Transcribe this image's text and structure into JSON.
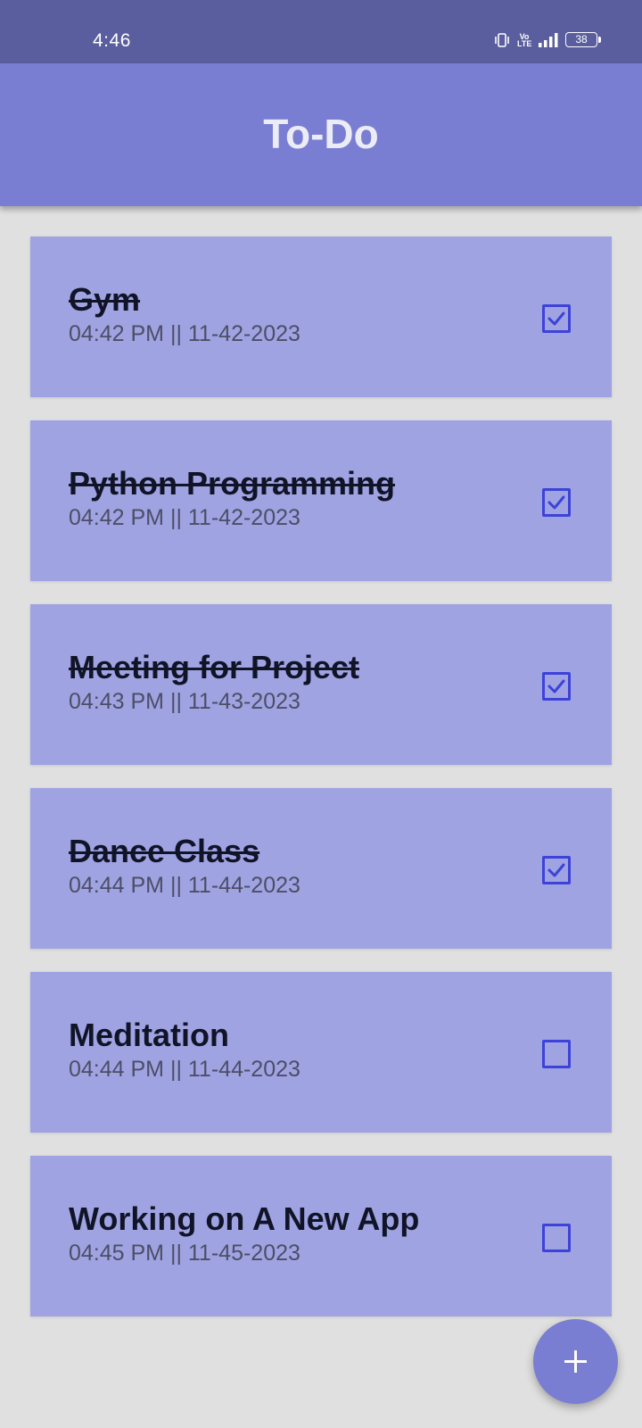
{
  "status_bar": {
    "time": "4:46",
    "volte": "Vo\nLTE",
    "battery": "38"
  },
  "app_bar": {
    "title": "To-Do"
  },
  "todos": [
    {
      "title": "Gym",
      "time": "04:42 PM || 11-42-2023",
      "done": true
    },
    {
      "title": "Python Programming",
      "time": "04:42 PM || 11-42-2023",
      "done": true
    },
    {
      "title": "Meeting for Project",
      "time": "04:43 PM || 11-43-2023",
      "done": true
    },
    {
      "title": "Dance Class",
      "time": "04:44 PM || 11-44-2023",
      "done": true
    },
    {
      "title": "Meditation",
      "time": "04:44 PM || 11-44-2023",
      "done": false
    },
    {
      "title": "Working on A New App",
      "time": "04:45 PM || 11-45-2023",
      "done": false
    }
  ],
  "fab": {
    "icon": "plus-icon"
  },
  "colors": {
    "status_bar": "#5a5e9e",
    "app_bar": "#7a7ed2",
    "card": "#9fa3e2",
    "background": "#e0e0e0",
    "checkbox": "#3d42d9"
  }
}
